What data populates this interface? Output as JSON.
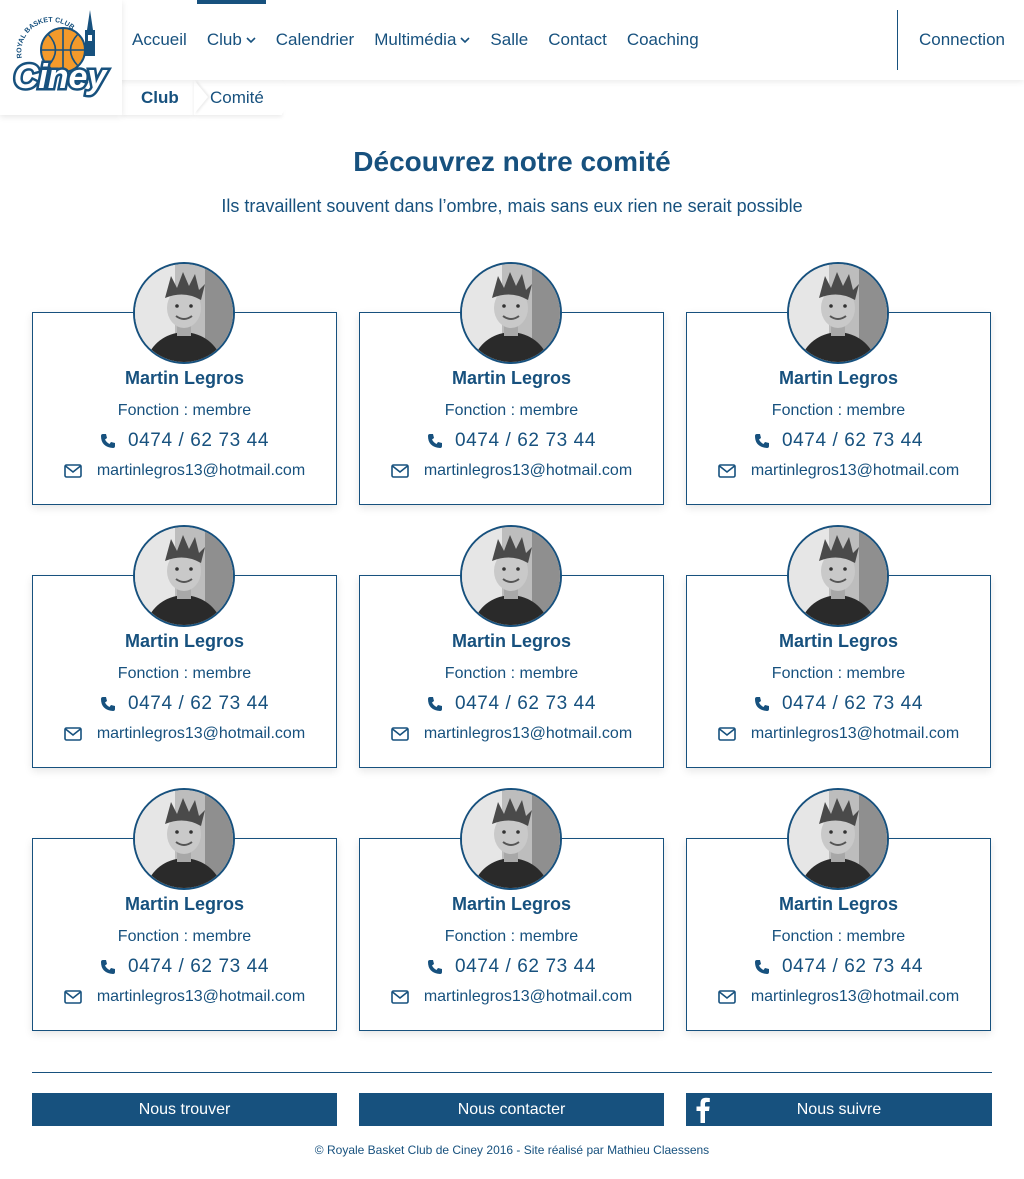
{
  "brand": {
    "logo_top_text": "ROYAL BASKET CLUB",
    "logo_main_text": "Ciney",
    "primary_color": "#17517e",
    "ball_color": "#f39a2b"
  },
  "nav": {
    "items": [
      {
        "label": "Accueil",
        "dropdown": false,
        "active": false
      },
      {
        "label": "Club",
        "dropdown": true,
        "active": true
      },
      {
        "label": "Calendrier",
        "dropdown": false,
        "active": false
      },
      {
        "label": "Multimédia",
        "dropdown": true,
        "active": false
      },
      {
        "label": "Salle",
        "dropdown": false,
        "active": false
      },
      {
        "label": "Contact",
        "dropdown": false,
        "active": false
      },
      {
        "label": "Coaching",
        "dropdown": false,
        "active": false
      }
    ],
    "connect_label": "Connection"
  },
  "breadcrumb": [
    "Club",
    "Comité"
  ],
  "page": {
    "title": "Découvrez notre comité",
    "subtitle": "Ils travaillent souvent dans l’ombre, mais sans eux rien ne serait possible"
  },
  "members": [
    {
      "name": "Martin Legros",
      "role": "Fonction : membre",
      "phone": "0474 / 62 73 44",
      "email": "martinlegros13@hotmail.com"
    },
    {
      "name": "Martin Legros",
      "role": "Fonction : membre",
      "phone": "0474 / 62 73 44",
      "email": "martinlegros13@hotmail.com"
    },
    {
      "name": "Martin Legros",
      "role": "Fonction : membre",
      "phone": "0474 / 62 73 44",
      "email": "martinlegros13@hotmail.com"
    },
    {
      "name": "Martin Legros",
      "role": "Fonction : membre",
      "phone": "0474 / 62 73 44",
      "email": "martinlegros13@hotmail.com"
    },
    {
      "name": "Martin Legros",
      "role": "Fonction : membre",
      "phone": "0474 / 62 73 44",
      "email": "martinlegros13@hotmail.com"
    },
    {
      "name": "Martin Legros",
      "role": "Fonction : membre",
      "phone": "0474 / 62 73 44",
      "email": "martinlegros13@hotmail.com"
    },
    {
      "name": "Martin Legros",
      "role": "Fonction : membre",
      "phone": "0474 / 62 73 44",
      "email": "martinlegros13@hotmail.com"
    },
    {
      "name": "Martin Legros",
      "role": "Fonction : membre",
      "phone": "0474 / 62 73 44",
      "email": "martinlegros13@hotmail.com"
    },
    {
      "name": "Martin Legros",
      "role": "Fonction : membre",
      "phone": "0474 / 62 73 44",
      "email": "martinlegros13@hotmail.com"
    }
  ],
  "footer": {
    "buttons": [
      {
        "label": "Nous trouver",
        "icon": null
      },
      {
        "label": "Nous contacter",
        "icon": null
      },
      {
        "label": "Nous suivre",
        "icon": "facebook-icon"
      }
    ],
    "copyright": "© Royale Basket Club de Ciney 2016 - Site réalisé par Mathieu Claessens"
  }
}
